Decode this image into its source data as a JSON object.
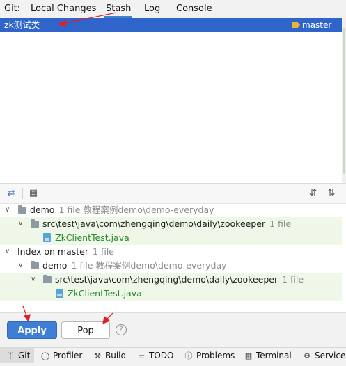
{
  "tabs": {
    "git_label": "Git:",
    "items": [
      {
        "label": "Local Changes"
      },
      {
        "label": "Stash"
      },
      {
        "label": "Log"
      },
      {
        "label": "Console"
      }
    ],
    "active": "Stash"
  },
  "stash_list": {
    "selected": {
      "name": "zk测试类",
      "branch": "master"
    }
  },
  "changes_tree": {
    "groups": [
      {
        "label": "demo",
        "meta": "1 file  教程案例demo\\demo-everyday",
        "folder": {
          "label": "src\\test\\java\\com\\zhengqing\\demo\\daily\\zookeeper",
          "meta": "1 file"
        },
        "file": {
          "label": "ZkClientTest.java"
        }
      },
      {
        "label": "Index on master",
        "meta": "1 file",
        "module": {
          "label": "demo",
          "meta": "1 file  教程案例demo\\demo-everyday"
        },
        "folder": {
          "label": "src\\test\\java\\com\\zhengqing\\demo\\daily\\zookeeper",
          "meta": "1 file"
        },
        "file": {
          "label": "ZkClientTest.java"
        }
      }
    ]
  },
  "buttons": {
    "apply": "Apply",
    "pop": "Pop",
    "help": "?"
  },
  "tool_windows": [
    {
      "label": "Git",
      "icon": "git-branch-icon"
    },
    {
      "label": "Profiler",
      "icon": "profiler-icon"
    },
    {
      "label": "Build",
      "icon": "hammer-icon"
    },
    {
      "label": "TODO",
      "icon": "list-icon"
    },
    {
      "label": "Problems",
      "icon": "warning-icon"
    },
    {
      "label": "Terminal",
      "icon": "terminal-icon"
    },
    {
      "label": "Services",
      "icon": "services-icon"
    }
  ],
  "colors": {
    "selection": "#2f65ca",
    "apply_button": "#3e7fd6",
    "modified_text": "#2b8a2b",
    "annotation": "#e02020"
  }
}
